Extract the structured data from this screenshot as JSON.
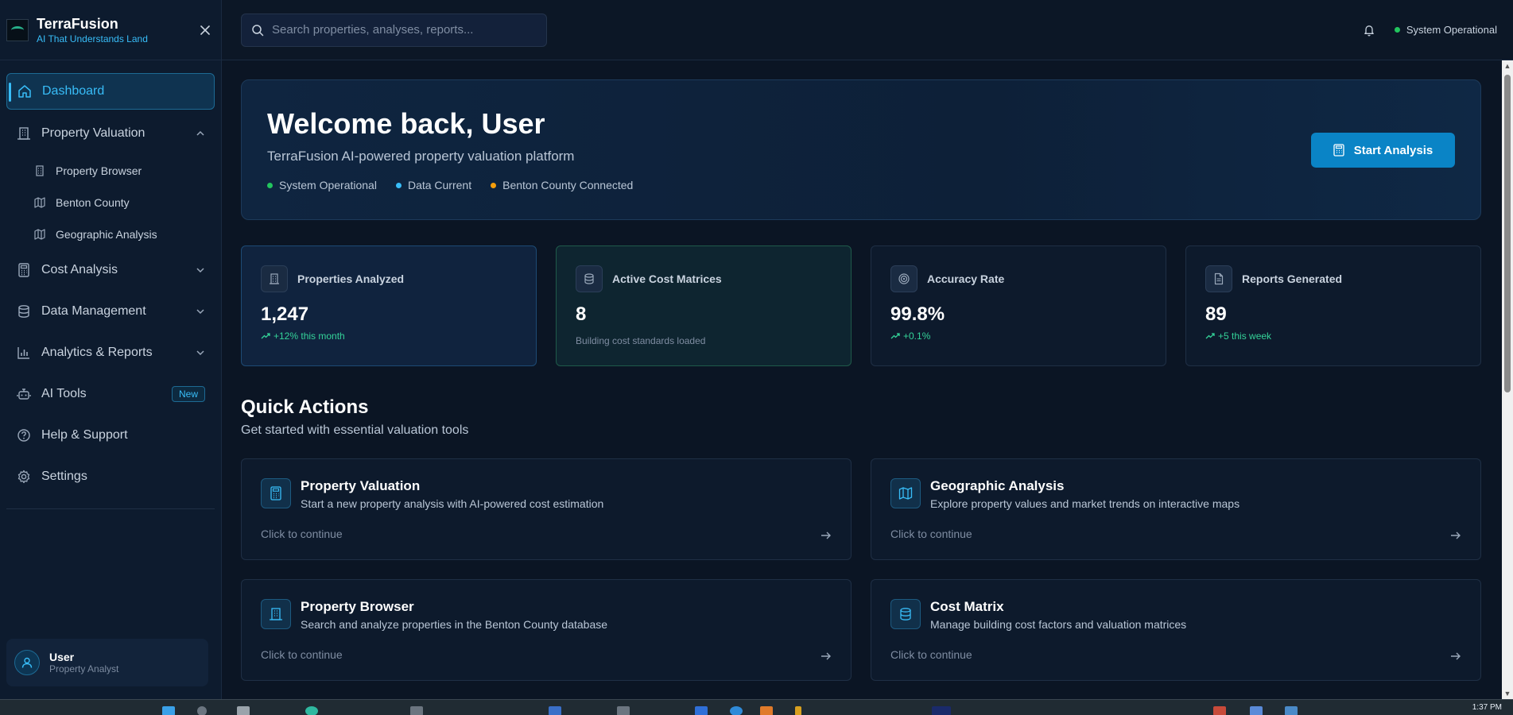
{
  "app": {
    "name": "TerraFusion",
    "tagline": "AI That Understands Land"
  },
  "sidebar": {
    "items": [
      {
        "label": "Dashboard",
        "icon": "home-icon",
        "active": true
      },
      {
        "label": "Property Valuation",
        "icon": "building-icon",
        "expanded": true,
        "children": [
          {
            "label": "Property Browser",
            "icon": "building-icon"
          },
          {
            "label": "Benton County",
            "icon": "map-icon"
          },
          {
            "label": "Geographic Analysis",
            "icon": "map-icon"
          }
        ]
      },
      {
        "label": "Cost Analysis",
        "icon": "calculator-icon",
        "expanded": false
      },
      {
        "label": "Data Management",
        "icon": "database-icon",
        "expanded": false
      },
      {
        "label": "Analytics & Reports",
        "icon": "bar-chart-icon",
        "expanded": false
      },
      {
        "label": "AI Tools",
        "icon": "bot-icon",
        "badge": "New"
      },
      {
        "label": "Help & Support",
        "icon": "help-circle-icon"
      },
      {
        "label": "Settings",
        "icon": "gear-icon"
      }
    ],
    "user": {
      "name": "User",
      "role": "Property Analyst"
    }
  },
  "topbar": {
    "search_placeholder": "Search properties, analyses, reports...",
    "status": "System Operational"
  },
  "hero": {
    "title": "Welcome back, User",
    "subtitle": "TerraFusion AI-powered property valuation platform",
    "statuses": [
      {
        "label": "System Operational",
        "color": "#22c55e"
      },
      {
        "label": "Data Current",
        "color": "#38bdf8"
      },
      {
        "label": "Benton County Connected",
        "color": "#f59e0b"
      }
    ],
    "cta": "Start Analysis"
  },
  "stats": [
    {
      "title": "Properties Analyzed",
      "value": "1,247",
      "delta": "+12% this month",
      "icon": "building-icon"
    },
    {
      "title": "Active Cost Matrices",
      "value": "8",
      "note": "Building cost standards loaded",
      "icon": "database-icon"
    },
    {
      "title": "Accuracy Rate",
      "value": "99.8%",
      "delta": "+0.1%",
      "icon": "target-icon"
    },
    {
      "title": "Reports Generated",
      "value": "89",
      "delta": "+5 this week",
      "icon": "document-icon"
    }
  ],
  "quick_actions": {
    "title": "Quick Actions",
    "subtitle": "Get started with essential valuation tools",
    "cta": "Click to continue",
    "cards": [
      {
        "title": "Property Valuation",
        "desc": "Start a new property analysis with AI-powered cost estimation",
        "icon": "calculator-icon"
      },
      {
        "title": "Geographic Analysis",
        "desc": "Explore property values and market trends on interactive maps",
        "icon": "map-icon"
      },
      {
        "title": "Property Browser",
        "desc": "Search and analyze properties in the Benton County database",
        "icon": "building-icon"
      },
      {
        "title": "Cost Matrix",
        "desc": "Manage building cost factors and valuation matrices",
        "icon": "database-icon"
      }
    ]
  },
  "taskbar": {
    "clock": "1:37 PM"
  },
  "colors": {
    "accent": "#38bdf8",
    "primary_button": "#0a84c6",
    "success": "#34d399",
    "background": "#0b1524"
  }
}
